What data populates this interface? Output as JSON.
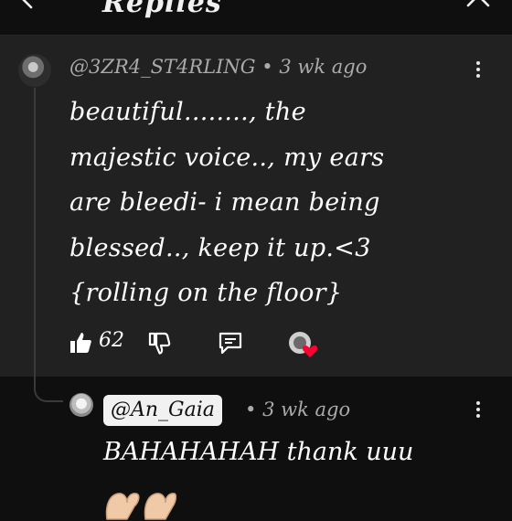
{
  "header": {
    "title": "Replies"
  },
  "comment": {
    "handle": "@3ZR4_ST4RLING",
    "separator": "•",
    "time": "3 wk ago",
    "lines": [
      "beautiful........, the",
      "majestic voice.., my ears",
      "are bleedi- i mean being",
      "blessed.., keep it up.<3",
      "{rolling on the floor}"
    ],
    "like_count": "62"
  },
  "reply": {
    "mention": "@An_Gaia",
    "separator": "•",
    "time": "3 wk ago",
    "text": "BAHAHAHAH thank uuu",
    "emoji": "🫶🫶"
  },
  "colors": {
    "background": "#0f0f0f",
    "highlight_panel": "#212121",
    "meta_text": "#aaaaaa",
    "heart": "#ff0033"
  }
}
